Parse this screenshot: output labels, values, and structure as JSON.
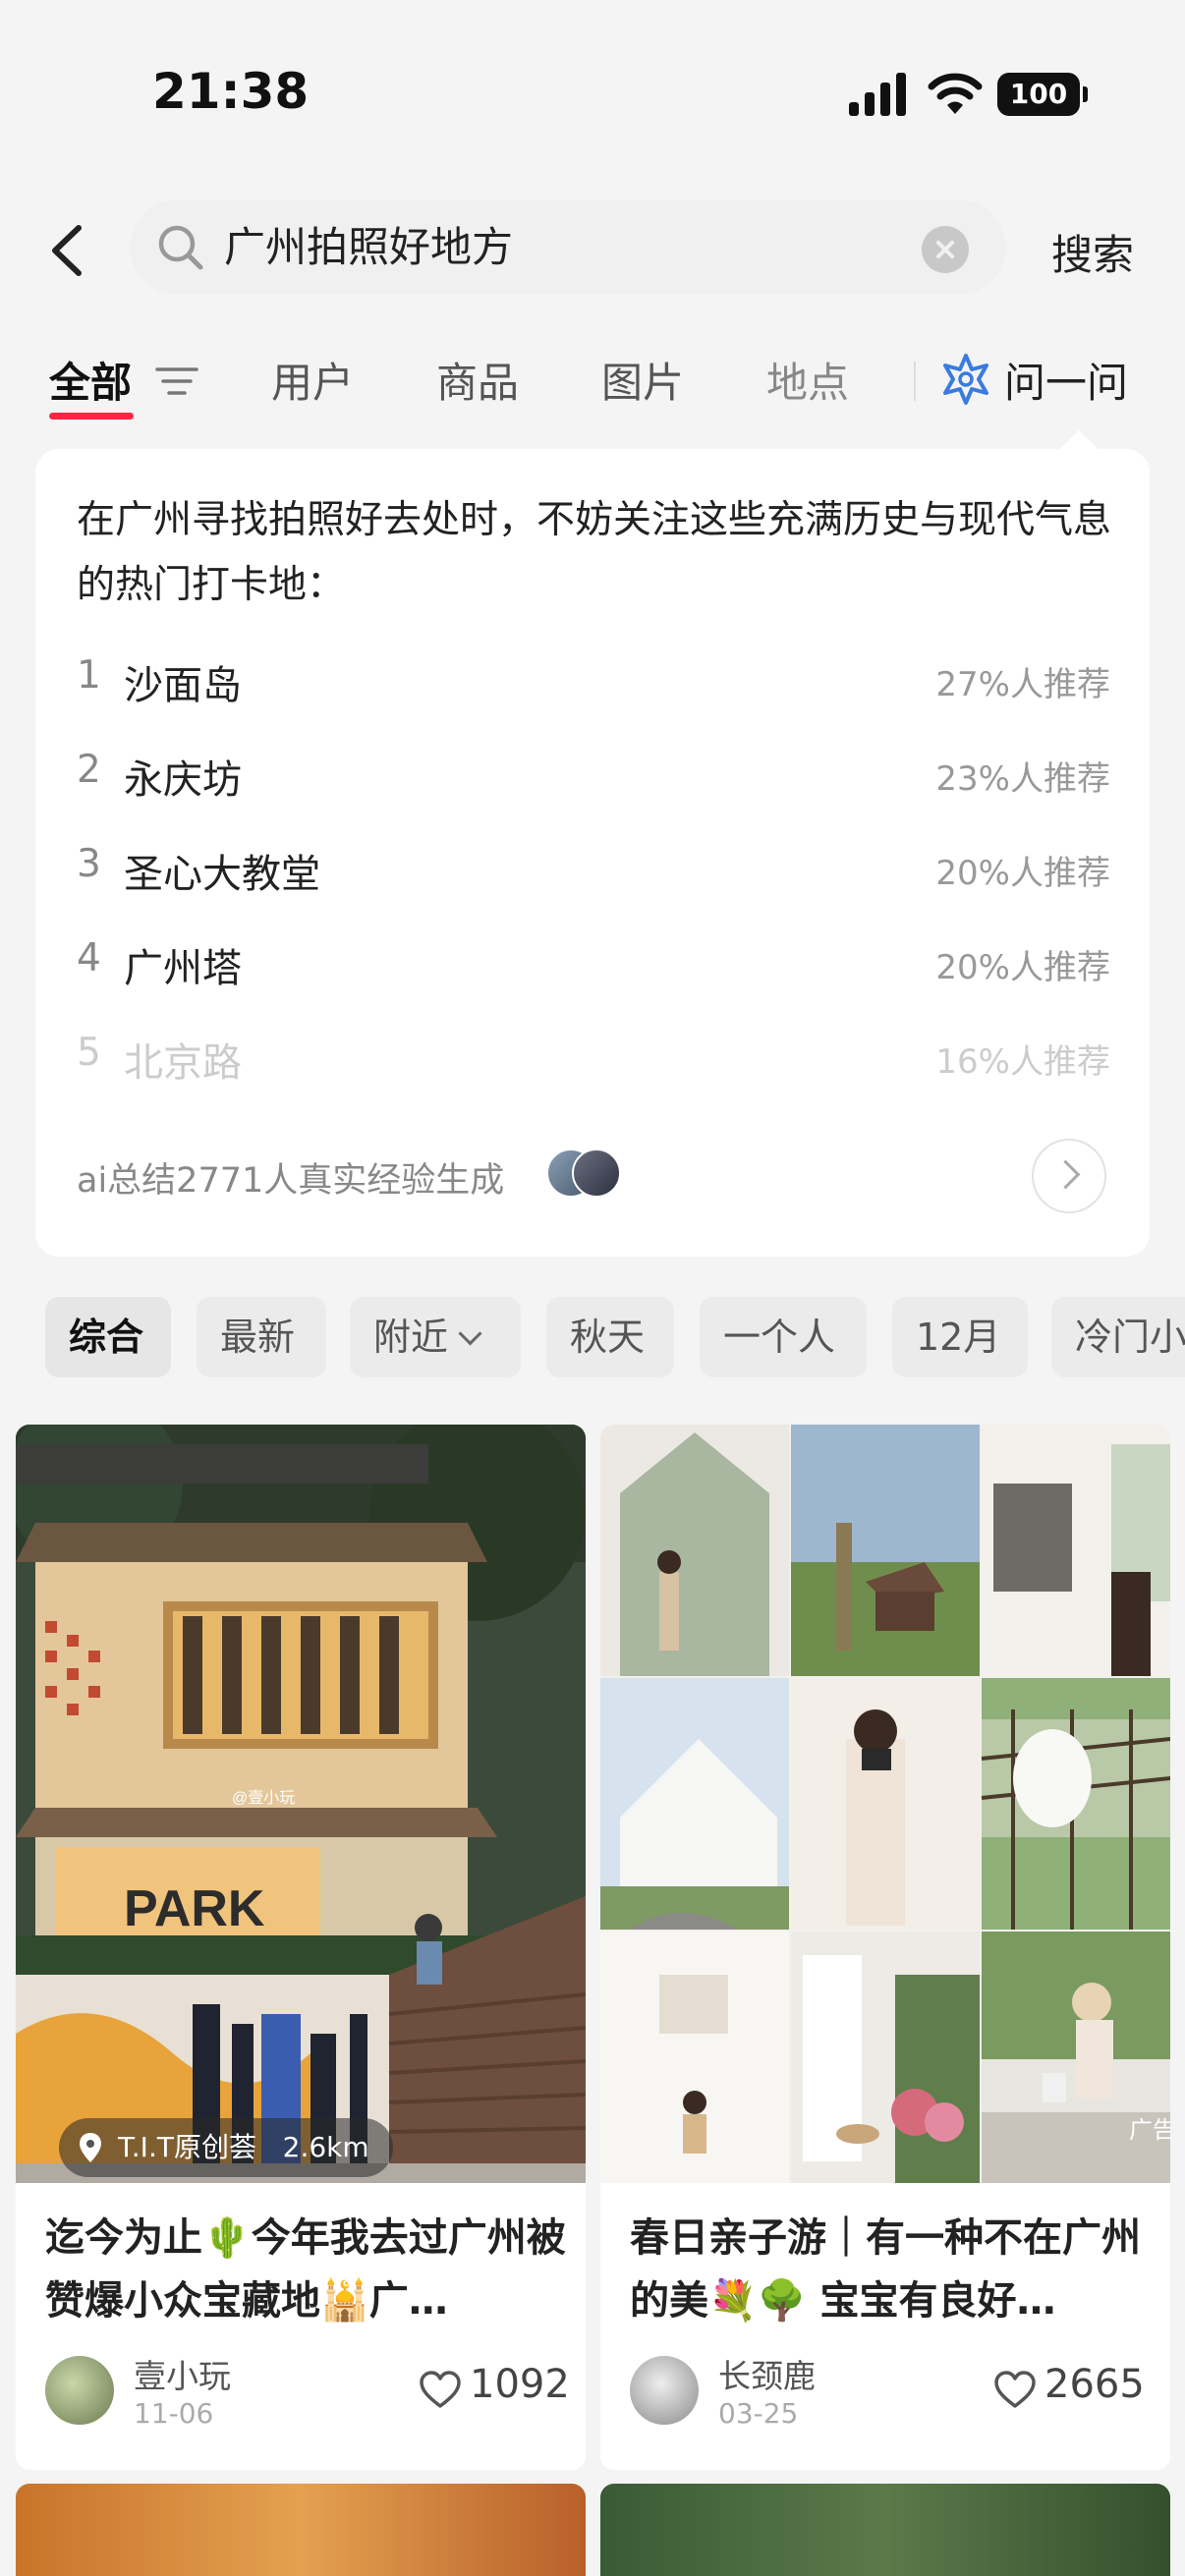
{
  "status_bar": {
    "time": "21:38",
    "battery": "100"
  },
  "search": {
    "query": "广州拍照好地方",
    "button": "搜索"
  },
  "tabs": {
    "all": "全部",
    "users": "用户",
    "goods": "商品",
    "images": "图片",
    "places": "地点",
    "ask": "问一问"
  },
  "ai_card": {
    "intro": "在广州寻找拍照好去处时，不妨关注这些充满历史与现代气息的热门打卡地：",
    "items": [
      {
        "rank": "1",
        "place": "沙面岛",
        "percent": "27%人推荐"
      },
      {
        "rank": "2",
        "place": "永庆坊",
        "percent": "23%人推荐"
      },
      {
        "rank": "3",
        "place": "圣心大教堂",
        "percent": "20%人推荐"
      },
      {
        "rank": "4",
        "place": "广州塔",
        "percent": "20%人推荐"
      },
      {
        "rank": "5",
        "place": "北京路",
        "percent": "16%人推荐"
      }
    ],
    "footer": "ai总结2771人真实经验生成"
  },
  "chips": [
    "综合",
    "最新",
    "附近",
    "秋天",
    "一个人",
    "12月",
    "冷门小"
  ],
  "notes": [
    {
      "title": "迄今为止🌵今年我去过广州被赞爆小众宝藏地🕌广…",
      "author": "壹小玩",
      "date": "11-06",
      "likes": "1092",
      "location": "T.I.T原创荟",
      "distance": "2.6km",
      "watermark": "@壹小玩",
      "sign_text": "PARK"
    },
    {
      "title": "春日亲子游｜有一种不在广州的美💐🌳 宝宝有良好…",
      "author": "长颈鹿",
      "date": "03-25",
      "likes": "2665",
      "ad": "广告"
    }
  ],
  "colors": {
    "accent": "#ff2442",
    "ask_icon": "#3a7be0"
  }
}
